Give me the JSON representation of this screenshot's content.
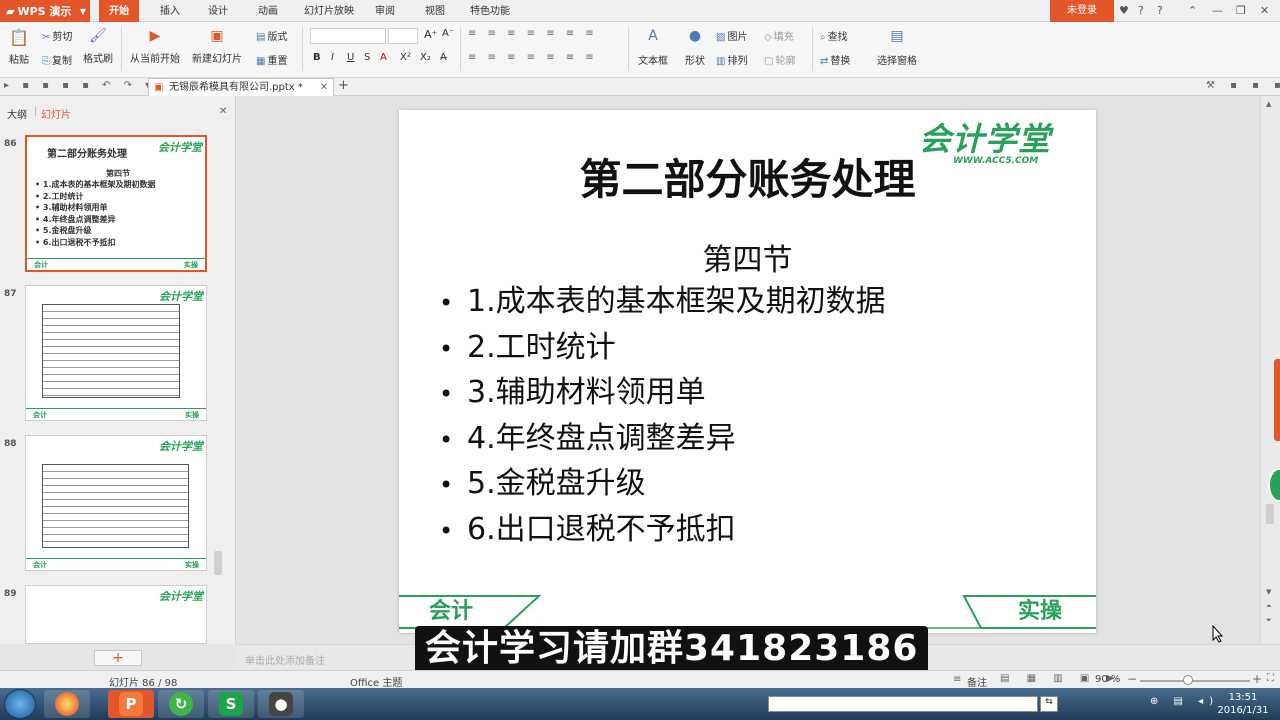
{
  "app": {
    "name": "WPS 演示",
    "login": "未登录"
  },
  "menu_tabs": [
    "开始",
    "插入",
    "设计",
    "动画",
    "幻灯片放映",
    "审阅",
    "视图",
    "特色功能"
  ],
  "active_tab": "开始",
  "ribbon": {
    "paste": "粘贴",
    "cut": "剪切",
    "copy": "复制",
    "format_painter": "格式刷",
    "from_start": "从当前开始",
    "new_slide": "新建幻灯片",
    "layout": "版式",
    "reset": "重置",
    "textbox": "文本框",
    "shape": "形状",
    "picture": "图片",
    "fill": "填充",
    "arrange": "排列",
    "outline": "轮廓",
    "find": "查找",
    "replace": "替换",
    "selection_pane": "选择窗格"
  },
  "document": {
    "tab": "无锡辰希模具有限公司.pptx *"
  },
  "panel": {
    "outline_tab": "大纲",
    "slides_tab": "幻灯片"
  },
  "thumbnails": [
    {
      "num": "86",
      "title": "第二部分账务处理",
      "section": "第四节",
      "items": [
        "1.成本表的基本框架及期初数据",
        "2.工时统计",
        "3.辅助材料领用单",
        "4.年终盘点调整差异",
        "5.金税盘升级",
        "6.出口退税不予抵扣"
      ]
    },
    {
      "num": "87"
    },
    {
      "num": "88"
    },
    {
      "num": "89"
    }
  ],
  "thumb_logo": "会计学堂",
  "thumb_foot_left": "会计",
  "thumb_foot_right": "实操",
  "slide": {
    "title": "第二部分账务处理",
    "logo": "会计学堂",
    "logo_url": "WWW.ACC5.COM",
    "section": "第四节",
    "bullets": [
      "1.成本表的基本框架及期初数据",
      "2.工时统计",
      "3.辅助材料领用单",
      "4.年终盘点调整差异",
      "5.金税盘升级",
      "6.出口退税不予抵扣"
    ],
    "footer_left": "会计",
    "footer_right": "实操"
  },
  "notes_placeholder": "单击此处添加备注",
  "overlay_subtitle": "会计学习请加群341823186",
  "status": {
    "slide_counter": "幻灯片 86 / 98",
    "theme": "Office 主题",
    "notes": "备注",
    "zoom": "90 %"
  },
  "taskbar": {
    "time": "13:51",
    "date": "2016/1/31"
  }
}
